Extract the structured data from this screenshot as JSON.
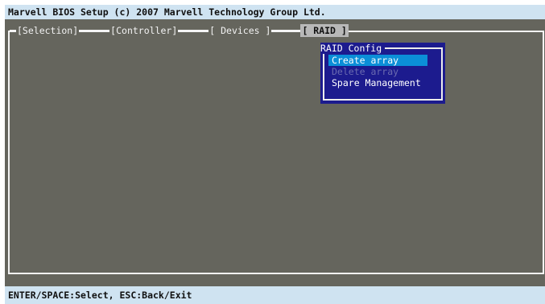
{
  "title_bar": {
    "text": "Marvell BIOS Setup (c) 2007 Marvell Technology Group Ltd."
  },
  "tabs": [
    {
      "label": "[Selection]"
    },
    {
      "label": "[Controller]"
    },
    {
      "label": "[ Devices ]"
    },
    {
      "label": "[ RAID ]",
      "active": true
    }
  ],
  "raid_menu": {
    "title": "RAID Config",
    "items": [
      {
        "label": "Create array",
        "state": "selected"
      },
      {
        "label": "Delete array",
        "state": "disabled"
      },
      {
        "label": "Spare Management",
        "state": "normal"
      }
    ]
  },
  "status_bar": {
    "text": "ENTER/SPACE:Select, ESC:Back/Exit"
  },
  "colors": {
    "background": "#65655d",
    "bar": "#cfe3f1",
    "menu": "#1c1b8e",
    "highlight": "#0b8fd8",
    "active_tab": "#b8b8b8"
  }
}
